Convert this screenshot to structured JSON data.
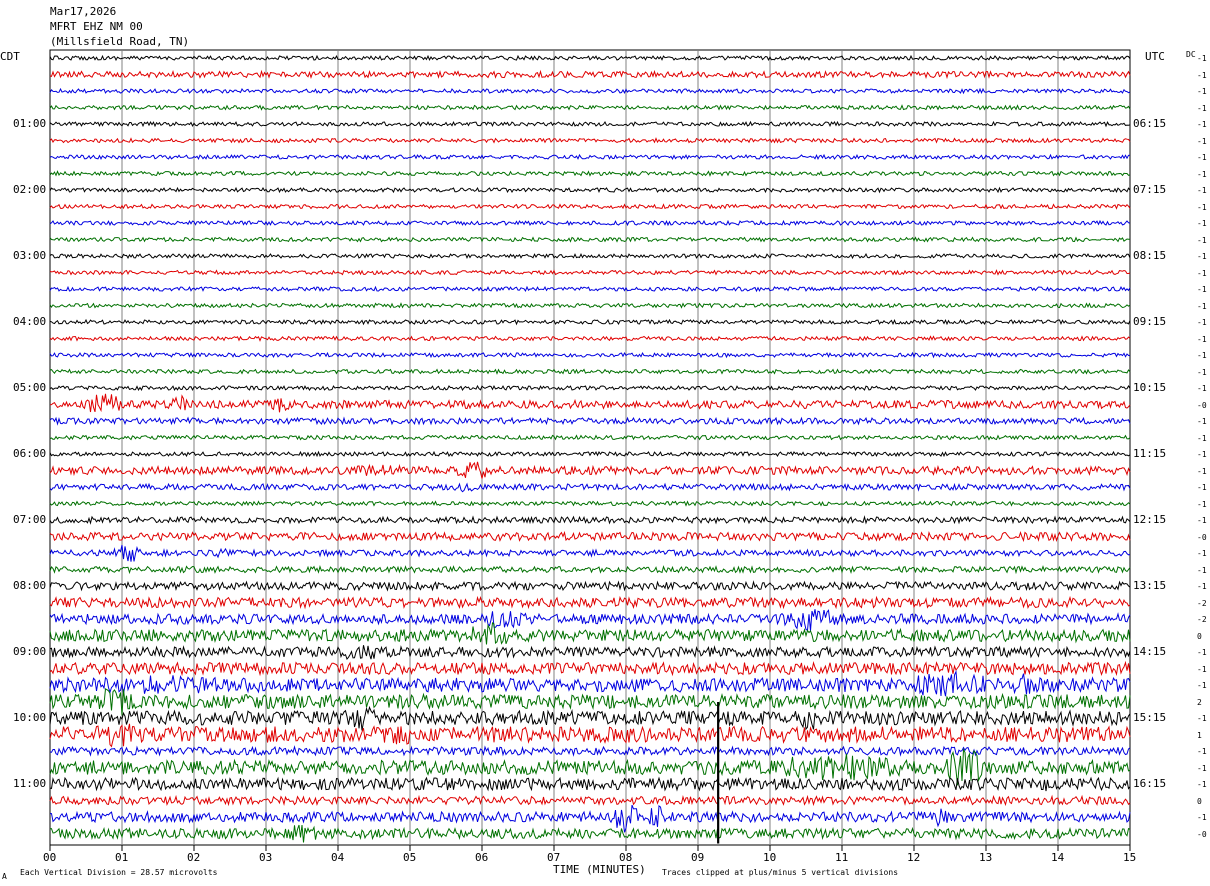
{
  "header": {
    "date": "Mar17,2026",
    "station": "MFRT EHZ NM 00",
    "location": "(Millsfield Road, TN)"
  },
  "left_timezone": "CDT",
  "right_timezone": "UTC",
  "dc_label": "DC",
  "left_hour_labels": [
    "01:00",
    "02:00",
    "03:00",
    "04:00",
    "05:00",
    "06:00",
    "07:00",
    "08:00",
    "09:00",
    "10:00",
    "11:00"
  ],
  "right_hour_labels": [
    "06:15",
    "07:15",
    "08:15",
    "09:15",
    "10:15",
    "11:15",
    "12:15",
    "13:15",
    "14:15",
    "15:15",
    "16:15"
  ],
  "dc_offsets": [
    "-1",
    "-1",
    "-1",
    "-1",
    "-1",
    "-1",
    "-1",
    "-1",
    "-1",
    "-1",
    "-1",
    "-1",
    "-1",
    "-1",
    "-1",
    "-1",
    "-1",
    "-1",
    "-1",
    "-1",
    "-1",
    "-0",
    "-1",
    "-1",
    "-1",
    "-1",
    "-1",
    "-1",
    "-1",
    "-0",
    "-1",
    "-1",
    "-1",
    "-2",
    "-2",
    "0",
    "-1",
    "-1",
    "-1",
    "2",
    "-1",
    "1",
    "-1",
    "-1",
    "-1",
    "0",
    "-1",
    "-0"
  ],
  "footer": {
    "scale_note": "Each Vertical Division =   28.57 microvolts",
    "clip_note": "Traces clipped at plus/minus 5 vertical divisions",
    "xlabel": "TIME (MINUTES)",
    "corner_mark": "A"
  },
  "colors": {
    "trace_cycle": [
      "#000000",
      "#e00000",
      "#0000e0",
      "#007000"
    ],
    "grid": "#808080"
  },
  "chart_data": {
    "type": "line",
    "title": "Mar17,2026 MFRT EHZ NM 00 (Millsfield Road, TN)",
    "xlabel": "TIME (MINUTES)",
    "ylabel": "",
    "xlim": [
      0,
      15
    ],
    "x_tick_labels": [
      "00",
      "01",
      "02",
      "03",
      "04",
      "05",
      "06",
      "07",
      "08",
      "09",
      "10",
      "11",
      "12",
      "13",
      "14",
      "15"
    ],
    "rows": 48,
    "minutes_per_row": 15,
    "start_time_local": "00:00",
    "noise_amp": [
      2,
      3,
      2,
      2,
      2,
      2,
      2,
      2,
      2,
      2,
      2,
      2,
      2,
      2,
      2,
      2,
      2,
      2,
      2,
      2,
      2,
      4,
      3,
      2,
      2,
      4,
      3,
      2,
      3,
      4,
      3,
      3,
      4,
      5,
      5,
      6,
      5,
      6,
      7,
      7,
      7,
      8,
      4,
      7,
      6,
      4,
      5,
      5
    ],
    "bursts": [
      {
        "row": 21,
        "t": 0.75,
        "w": 0.35,
        "a": 14
      },
      {
        "row": 21,
        "t": 1.8,
        "w": 0.2,
        "a": 10
      },
      {
        "row": 21,
        "t": 3.2,
        "w": 0.25,
        "a": 8
      },
      {
        "row": 25,
        "t": 4.5,
        "w": 1.0,
        "a": 6
      },
      {
        "row": 25,
        "t": 5.9,
        "w": 0.5,
        "a": 9
      },
      {
        "row": 26,
        "t": 5.7,
        "w": 0.4,
        "a": 6
      },
      {
        "row": 30,
        "t": 1.1,
        "w": 0.3,
        "a": 10
      },
      {
        "row": 30,
        "t": 2.4,
        "w": 0.3,
        "a": 5
      },
      {
        "row": 33,
        "t": 4.2,
        "w": 0.3,
        "a": 6
      },
      {
        "row": 34,
        "t": 6.3,
        "w": 0.6,
        "a": 10
      },
      {
        "row": 34,
        "t": 10.6,
        "w": 0.7,
        "a": 12
      },
      {
        "row": 35,
        "t": 6.1,
        "w": 0.5,
        "a": 14
      },
      {
        "row": 36,
        "t": 4.3,
        "w": 0.8,
        "a": 8
      },
      {
        "row": 38,
        "t": 1.5,
        "w": 2.0,
        "a": 10
      },
      {
        "row": 38,
        "t": 12.5,
        "w": 1.0,
        "a": 14
      },
      {
        "row": 38,
        "t": 13.5,
        "w": 0.5,
        "a": 12
      },
      {
        "row": 39,
        "t": 0.9,
        "w": 0.4,
        "a": 16
      },
      {
        "row": 40,
        "t": 4.3,
        "w": 0.4,
        "a": 14
      },
      {
        "row": 40,
        "t": 10.6,
        "w": 0.5,
        "a": 12
      },
      {
        "row": 41,
        "t": 0.9,
        "w": 0.6,
        "a": 14
      },
      {
        "row": 41,
        "t": 4.8,
        "w": 0.5,
        "a": 12
      },
      {
        "row": 41,
        "t": 8.3,
        "w": 0.6,
        "a": 8
      },
      {
        "row": 43,
        "t": 11.0,
        "w": 2.0,
        "a": 14
      },
      {
        "row": 43,
        "t": 12.7,
        "w": 0.4,
        "a": 22
      },
      {
        "row": 44,
        "t": 13.9,
        "w": 0.3,
        "a": 8
      },
      {
        "row": 46,
        "t": 8.0,
        "w": 0.3,
        "a": 16
      },
      {
        "row": 46,
        "t": 8.4,
        "w": 0.2,
        "a": 14
      },
      {
        "row": 46,
        "t": 12.4,
        "w": 0.2,
        "a": 12
      },
      {
        "row": 47,
        "t": 3.5,
        "w": 0.5,
        "a": 9
      }
    ],
    "spikes": [
      {
        "t": 9.28,
        "rows_from": 40,
        "rows_to": 47
      }
    ]
  }
}
